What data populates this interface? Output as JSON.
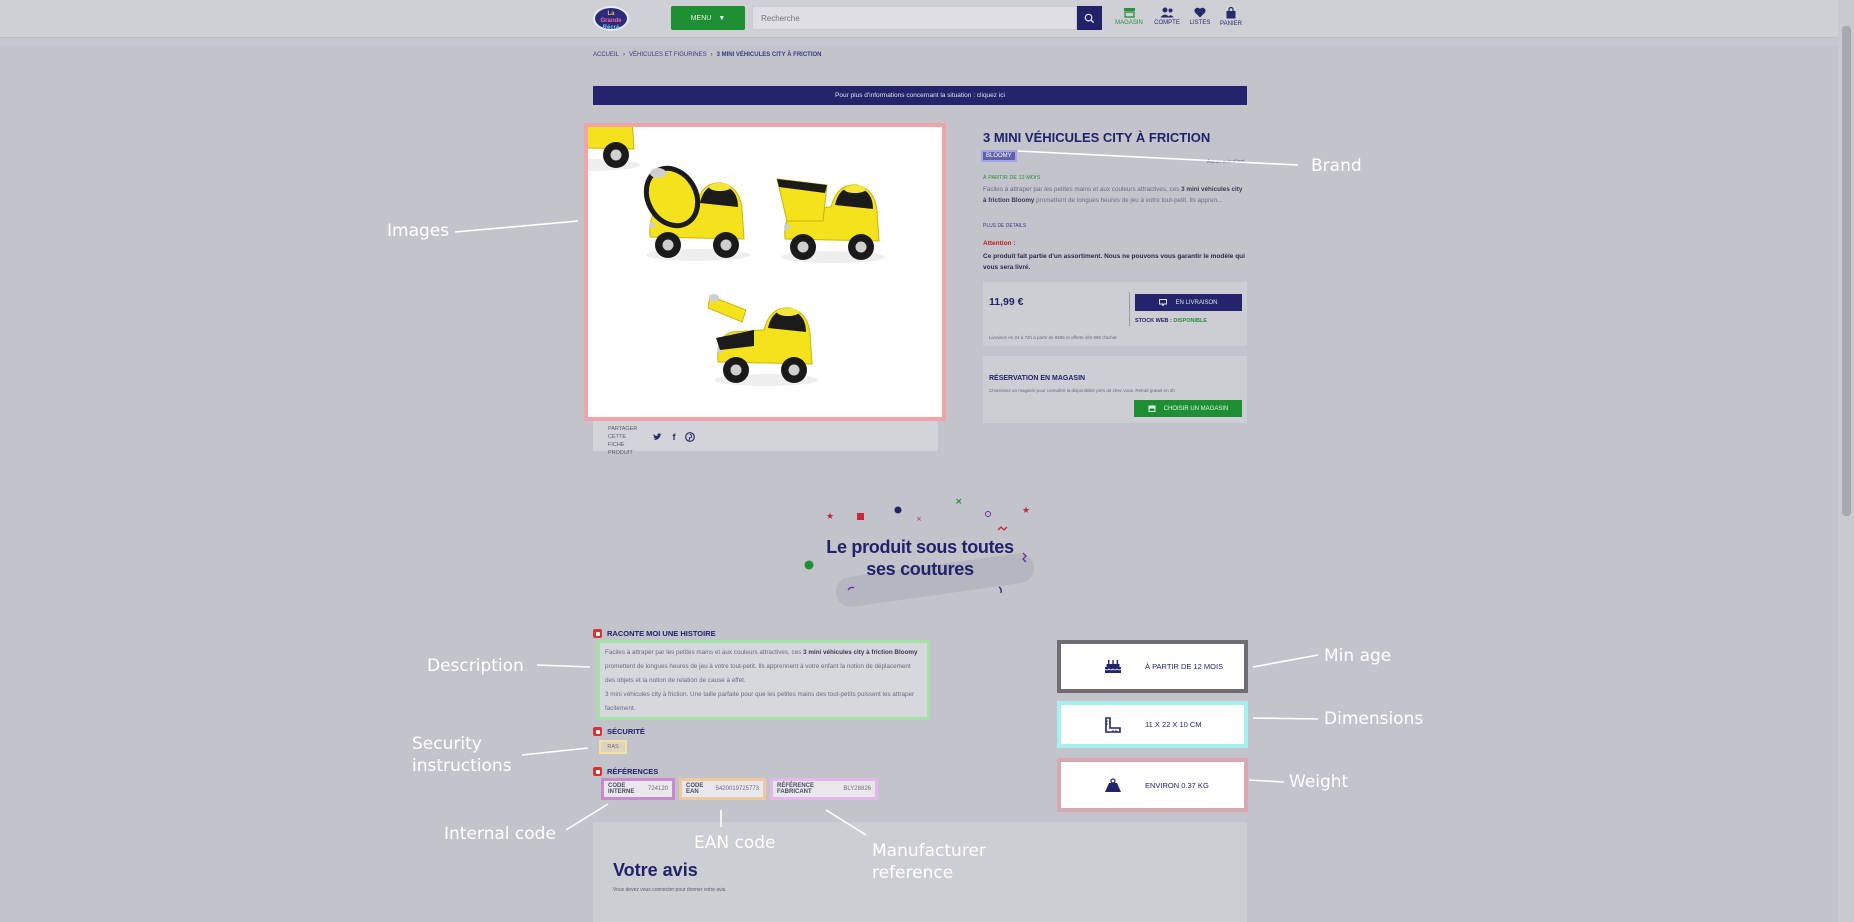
{
  "header": {
    "logo_text": [
      "La",
      "Grande",
      "Récré"
    ],
    "menu_label": "MENU",
    "search_placeholder": "Recherche",
    "nav": [
      {
        "label": "MAGASIN",
        "icon": "store-icon"
      },
      {
        "label": "COMPTE",
        "icon": "account-icon"
      },
      {
        "label": "LISTES",
        "icon": "heart-icon"
      },
      {
        "label": "PANIER",
        "icon": "bag-icon"
      }
    ]
  },
  "breadcrumb": [
    "ACCUEIL",
    "VÉHICULES ET FIGURINES",
    "3 MINI VÉHICULES CITY À FRICTION"
  ],
  "banner": "Pour plus d'informations concernant la situation : cliquez ici",
  "product": {
    "title": "3 MINI VÉHICULES CITY À FRICTION",
    "brand": "BLOOMY",
    "avis_link": "Aucun avis client",
    "age": "À PARTIR DE 12 MOIS",
    "short_desc_a": "Faciles à attraper par les petites mains et aux couleurs attractives, ces ",
    "short_desc_b": "3 mini véhicules city à friction Bloomy",
    "short_desc_c": " promettent de longues heures de jeu à votre tout-petit. Ils appren...",
    "more": "PLUS DE DÉTAILS",
    "attention_title": "Attention :",
    "attention_text": "Ce produit fait partie d'un assortiment. Nous ne pouvons vous garantir le modèle qui vous sera livré.",
    "price": "11,99 €",
    "delivery_btn": "EN LIVRAISON",
    "stock_label": "STOCK WEB :",
    "stock_value": "DISPONIBLE",
    "delivery_note": "Livraison en 24 à 72h à partir de 8€95 et offerte dès 89€ d'achat",
    "resa_title": "RÉSERVATION EN MAGASIN",
    "resa_desc": "Choisissez un magasin pour connaître la disponibilité près de chez vous. Retrait gratuit en 2h",
    "choose_btn": "CHOISIR UN MAGASIN",
    "share_label": "PARTAGER CETTE FICHE PRODUIT"
  },
  "coutures": {
    "line1": "Le produit sous toutes",
    "line2": "ses coutures"
  },
  "sections": {
    "story_title": "RACONTE MOI UNE HISTOIRE",
    "story_a": "Faciles à attraper par les petites mains et aux couleurs attractives, ces ",
    "story_b": "3 mini véhicules city à friction Bloomy",
    "story_c": " promettent de longues heures de jeu à votre tout-petit. Ils apprennent à votre enfant la notion de déplacement des objets et la notion de relation de cause à effet.",
    "story_d": "3 mini véhicules city à friction. Une taille parfaite pour que les petites mains des tout-petits puissent les attraper facilement.",
    "security_title": "SÉCURITÉ",
    "security_value": "RAS",
    "refs_title": "RÉFÉRENCES",
    "refs": [
      {
        "label": "CODE INTERNE",
        "value": "724120"
      },
      {
        "label": "CODE EAN",
        "value": "5420019725773"
      },
      {
        "label": "RÉFÉRENCE FABRICANT",
        "value": "BLY28826"
      }
    ]
  },
  "specs": [
    {
      "text": "À PARTIR DE 12 MOIS",
      "icon": "cake-icon"
    },
    {
      "text": "11 X 22 X 10 CM",
      "icon": "ruler-icon"
    },
    {
      "text": "ENVIRON 0.37 KG",
      "icon": "weight-icon"
    }
  ],
  "avis": {
    "title": "Votre avis",
    "desc": "Vous devez vous connecter pour donner votre avis."
  },
  "annotations": {
    "images": "Images",
    "brand": "Brand",
    "description": "Description",
    "security": "Security instructions",
    "internal": "Internal code",
    "ean": "EAN code",
    "manufacturer": "Manufacturer reference",
    "min_age": "Min age",
    "dimensions": "Dimensions",
    "weight": "Weight"
  },
  "colors": {
    "navy": "#22226a",
    "green": "#1f8f33",
    "overlay": "#c3c3cc"
  }
}
